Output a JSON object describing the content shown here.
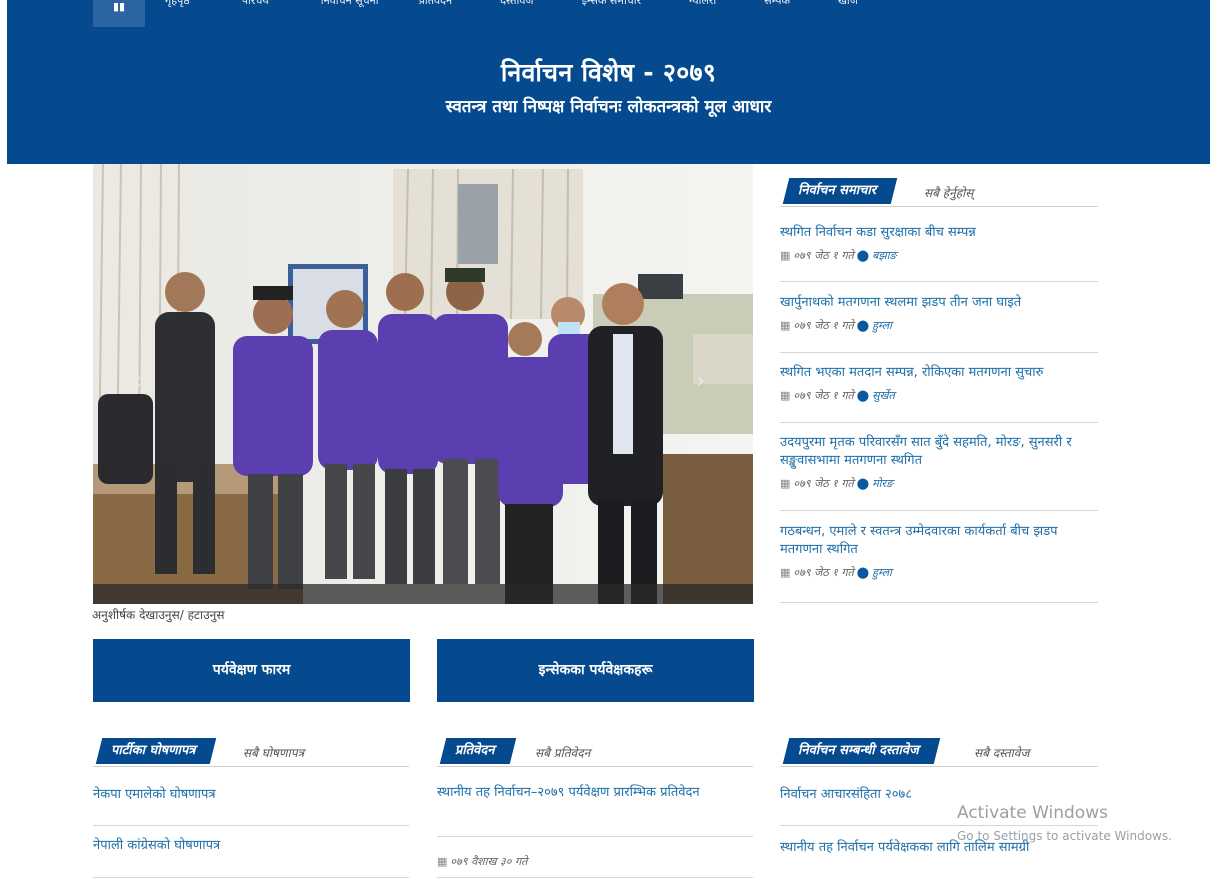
{
  "nav": {
    "menu_label": "▮▮",
    "items": [
      "गृहपृष्ठ",
      "परिचय",
      "निर्वाचन सूचना",
      "प्रतिवेदन",
      "दस्तावेज",
      "इन्सेक समाचार",
      "ग्यालेरी",
      "सम्पर्क",
      "खोज"
    ]
  },
  "hero": {
    "title": "निर्वाचन विशेष - २०७९",
    "subtitle": "स्वतन्त्र तथा निष्पक्ष निर्वाचनः लोकतन्त्रको मूल आधार"
  },
  "slider": {
    "caption_toggle": "अनुशीर्षक देखाउनुस/ हटाउनुस",
    "prev_glyph": "‹",
    "next_glyph": "›"
  },
  "news": {
    "tab_label": "निर्वाचन समाचार",
    "more_label": "सबै हेर्नुहोस्",
    "items": [
      {
        "title": "स्थगित निर्वाचन कडा सुरक्षाका बीच सम्पन्न",
        "date": "०७९ जेठ १ गते",
        "location": "बझाङ"
      },
      {
        "title": "खार्पुनाथको मतगणना स्थलमा झडप तीन जना घाइते",
        "date": "०७९ जेठ १ गते",
        "location": "हुम्ला"
      },
      {
        "title": "स्थगित भएका मतदान सम्पन्न, रोकिएका मतगणना सुचारु",
        "date": "०७९ जेठ १ गते",
        "location": "सुर्खेत"
      },
      {
        "title": "उदयपुरमा मृतक परिवारसँग सात बुँदे सहमति, मोरङ, सुनसरी र सङ्खुवासभामा मतगणना स्थगित",
        "date": "०७९ जेठ १ गते",
        "location": "मोरङ"
      },
      {
        "title": "गठबन्धन, एमाले र स्वतन्त्र उम्मेदवारका कार्यकर्ता बीच झडप मतगणना स्थगित",
        "date": "०७९ जेठ १ गते",
        "location": "हुम्ला"
      }
    ]
  },
  "buttons": {
    "observation_form": "पर्यवेक्षण फारम",
    "insec_observers": "इन्सेकका पर्यवेक्षकहरू"
  },
  "manifesto": {
    "tab_label": "पार्टीका घोषणापत्र",
    "more_label": "सबै घोषणापत्र",
    "items": [
      "नेकपा एमालेको घोषणापत्र",
      "नेपाली कांग्रेसको घोषणापत्र"
    ]
  },
  "reports": {
    "tab_label": "प्रतिवेदन",
    "more_label": "सबै प्रतिवेदन",
    "items": [
      {
        "title": "स्थानीय तह निर्वाचन–२०७९ पर्यवेक्षण प्रारम्भिक प्रतिवेदन",
        "date": "०७९ वैशाख ३० गते"
      }
    ]
  },
  "documents": {
    "tab_label": "निर्वाचन सम्बन्धी दस्तावेज",
    "more_label": "सबै दस्तावेज",
    "items": [
      "निर्वाचन आचारसंहिता २०७८",
      "स्थानीय तह निर्वाचन पर्यवेक्षकका लागि तालिम सामग्री"
    ]
  },
  "watermark": {
    "line1": "Activate Windows",
    "line2": "Go to Settings to activate Windows."
  },
  "colors": {
    "brand_blue": "#054a8f",
    "link_blue": "#1f6fa8",
    "vest_purple": "#5b3fb0"
  },
  "icons": {
    "calendar": "calendar-icon",
    "location": "map-pin-icon"
  }
}
